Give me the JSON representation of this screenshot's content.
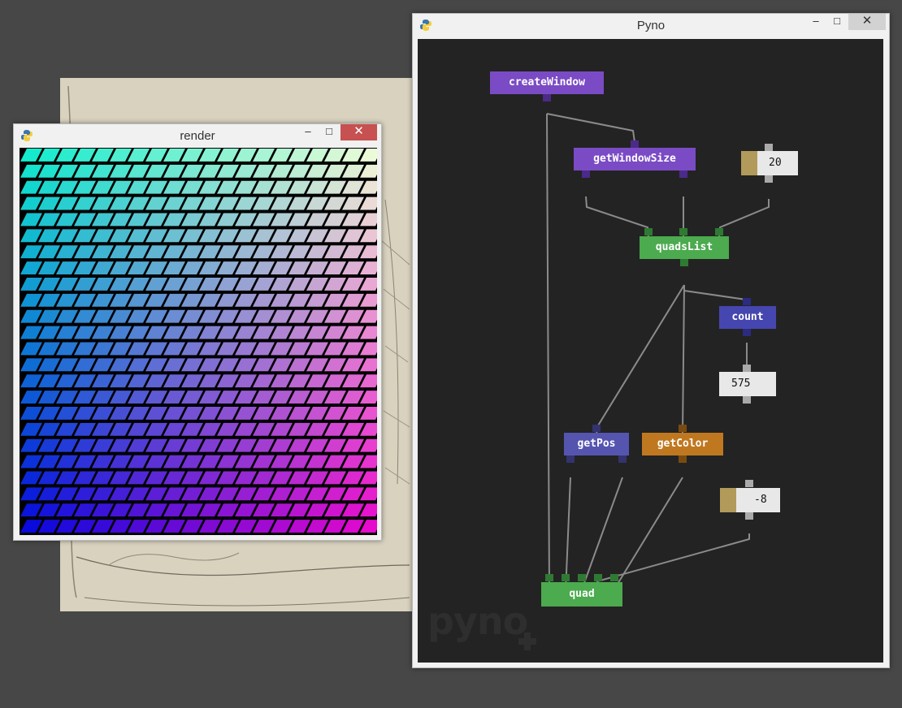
{
  "render_window": {
    "title": "render",
    "controls": {
      "minimize": "–",
      "maximize": "□",
      "close": "✕"
    },
    "grid": {
      "rows": 24,
      "cols": 20
    }
  },
  "pyno_window": {
    "title": "Pyno",
    "controls": {
      "minimize": "–",
      "maximize": "□",
      "close": "✕"
    },
    "watermark": "pyno"
  },
  "nodes": {
    "createWindow": "createWindow",
    "getWindowSize": "getWindowSize",
    "quadsList": "quadsList",
    "count": "count",
    "getPos": "getPos",
    "getColor": "getColor",
    "quad": "quad"
  },
  "fields": {
    "size_value": "20",
    "count_value": "575",
    "offset_value": "-8"
  },
  "colors": {
    "purple_node": "#7a4bc4",
    "green_node": "#4caa4f",
    "blue_node": "#4646b0",
    "slate_node": "#5555b0",
    "orange_node": "#c07820",
    "field_handle": "#b19a5a"
  }
}
